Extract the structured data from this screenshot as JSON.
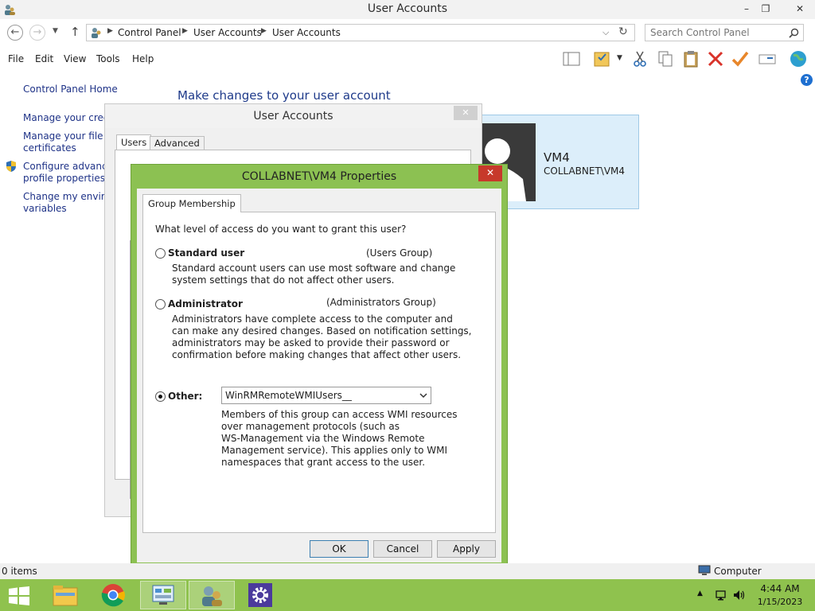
{
  "window": {
    "title": "User Accounts",
    "minimize": "–",
    "restore": "❐",
    "close": "✕"
  },
  "address": {
    "crumbs": [
      "Control Panel",
      "User Accounts",
      "User Accounts"
    ],
    "search_placeholder": "Search Control Panel"
  },
  "menu": [
    "File",
    "Edit",
    "View",
    "Tools",
    "Help"
  ],
  "sidebar": {
    "home": "Control Panel Home",
    "links": [
      {
        "line1": "Manage your crede",
        "line2": ""
      },
      {
        "line1": "Manage your file er",
        "line2": "certificates"
      },
      {
        "line1": "Configure advance",
        "line2": "profile properties"
      },
      {
        "line1": "Change my environ",
        "line2": "variables"
      }
    ]
  },
  "main": {
    "heading": "Make changes to your user account",
    "user_name": "VM4",
    "user_account": "COLLABNET\\VM4"
  },
  "ua_dialog": {
    "title": "User Accounts",
    "tabs": [
      "Users",
      "Advanced"
    ],
    "close": "✕"
  },
  "prop_dialog": {
    "title": "COLLABNET\\VM4 Properties",
    "close": "✕",
    "tab": "Group Membership",
    "question": "What level of access do you want to grant this user?",
    "options": [
      {
        "label": "Standard user",
        "group": "(Users Group)",
        "desc": [
          "Standard account users can use most software and change",
          "system settings that do not affect other users."
        ]
      },
      {
        "label": "Administrator",
        "group": "(Administrators Group)",
        "desc": [
          "Administrators have complete access to the computer and",
          "can make any desired changes. Based on notification settings,",
          "administrators may be asked to provide their password or",
          "confirmation before making changes that affect other users."
        ]
      }
    ],
    "other_label": "Other:",
    "other_value": "WinRMRemoteWMIUsers__",
    "other_desc": [
      "Members of this group can access WMI resources",
      "over management protocols (such as",
      "WS-Management via the Windows Remote",
      "Management service). This applies only to WMI",
      "namespaces that grant access to the user."
    ],
    "buttons": {
      "ok": "OK",
      "cancel": "Cancel",
      "apply": "Apply"
    }
  },
  "status": {
    "items": "0 items",
    "location": "Computer"
  },
  "taskbar": {
    "time": "4:44 AM",
    "date": "1/15/2023"
  },
  "colors": {
    "taskbar": "#8fc24e",
    "dialog_border": "#8cc152",
    "link": "#1e3287",
    "close_red": "#c7392b"
  }
}
